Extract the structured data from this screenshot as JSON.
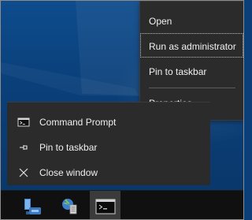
{
  "context_menu": {
    "items": [
      {
        "label": "Open"
      },
      {
        "label": "Run as administrator"
      },
      {
        "label": "Pin to taskbar"
      },
      {
        "label": "Properties"
      }
    ]
  },
  "jump_list": {
    "items": [
      {
        "label": "Command Prompt",
        "icon": "command-prompt-icon"
      },
      {
        "label": "Pin to taskbar",
        "icon": "pin-icon"
      },
      {
        "label": "Close window",
        "icon": "close-icon"
      }
    ]
  },
  "taskbar": {
    "apps": [
      {
        "name": "file-explorer-icon",
        "active": false
      },
      {
        "name": "control-panel-icon",
        "active": false
      },
      {
        "name": "command-prompt-taskbar-icon",
        "active": true
      }
    ]
  },
  "colors": {
    "menu_bg": "#2b2b2b",
    "taskbar_bg": "#101010",
    "active_bg": "#3b3b3b",
    "text": "#f2f2f2",
    "accent": "#8ab4ff"
  }
}
